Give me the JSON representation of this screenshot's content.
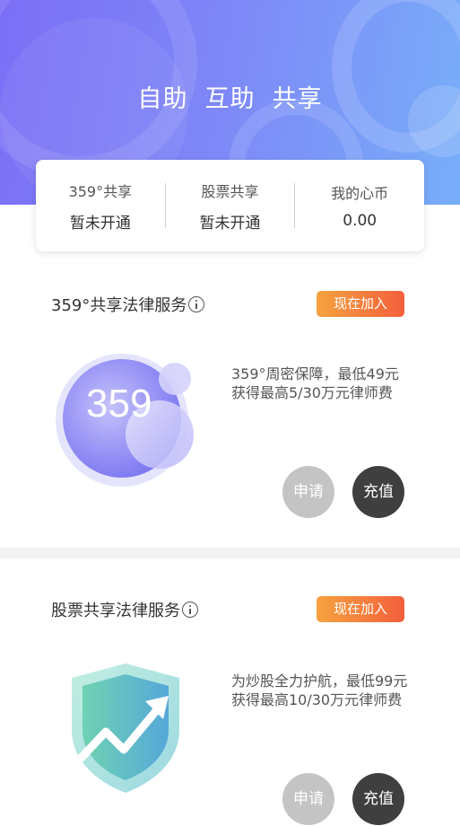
{
  "hero": {
    "title": "自助  互助  共享"
  },
  "stats": [
    {
      "title": "359°共享",
      "value": "暂未开通"
    },
    {
      "title": "股票共享",
      "value": "暂未开通"
    },
    {
      "title": "我的心币",
      "value": "0.00"
    }
  ],
  "services": [
    {
      "title": "359°共享法律服务",
      "join_label": "现在加入",
      "logo_text": "359",
      "description": "359°周密保障，最低49元获得最高5/30万元律师费",
      "apply_label": "申请",
      "recharge_label": "充值"
    },
    {
      "title": "股票共享法律服务",
      "join_label": "现在加入",
      "description": "为炒股全力护航，最低99元获得最高10/30万元律师费",
      "apply_label": "申请",
      "recharge_label": "充值"
    }
  ],
  "colors": {
    "hero_start": "#7b6ef6",
    "hero_end": "#78aef9",
    "join_start": "#f6a23f",
    "join_end": "#f3603c",
    "apply_bg": "#c4c4c4",
    "recharge_bg": "#3f3f3f"
  }
}
